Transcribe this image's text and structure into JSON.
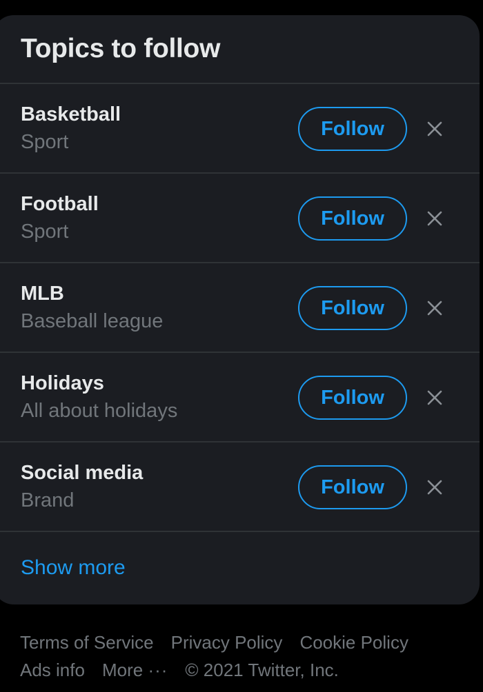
{
  "panel": {
    "title": "Topics to follow"
  },
  "topics": [
    {
      "name": "Basketball",
      "category": "Sport",
      "follow_label": "Follow"
    },
    {
      "name": "Football",
      "category": "Sport",
      "follow_label": "Follow"
    },
    {
      "name": "MLB",
      "category": "Baseball league",
      "follow_label": "Follow"
    },
    {
      "name": "Holidays",
      "category": "All about holidays",
      "follow_label": "Follow"
    },
    {
      "name": "Social media",
      "category": "Brand",
      "follow_label": "Follow"
    }
  ],
  "show_more_label": "Show more",
  "footer": {
    "terms": "Terms of Service",
    "privacy": "Privacy Policy",
    "cookie": "Cookie Policy",
    "ads": "Ads info",
    "more": "More",
    "more_icon": "···",
    "copyright": "© 2021 Twitter, Inc."
  },
  "colors": {
    "accent": "#1d9bf0",
    "panel_bg": "#1b1d22",
    "page_bg": "#000000",
    "primary_text": "#e7e9ea",
    "secondary_text": "#71767b"
  },
  "icons": {
    "dismiss": "close-icon",
    "more": "more-dots-icon"
  }
}
